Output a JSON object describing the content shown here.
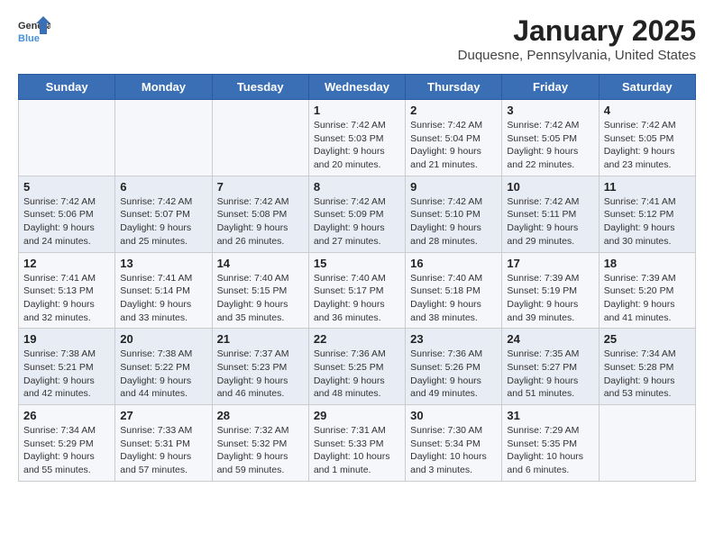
{
  "logo": {
    "text_general": "General",
    "text_blue": "Blue"
  },
  "calendar": {
    "title": "January 2025",
    "subtitle": "Duquesne, Pennsylvania, United States"
  },
  "days_of_week": [
    "Sunday",
    "Monday",
    "Tuesday",
    "Wednesday",
    "Thursday",
    "Friday",
    "Saturday"
  ],
  "weeks": [
    [
      {
        "day": "",
        "info": ""
      },
      {
        "day": "",
        "info": ""
      },
      {
        "day": "",
        "info": ""
      },
      {
        "day": "1",
        "info": "Sunrise: 7:42 AM\nSunset: 5:03 PM\nDaylight: 9 hours\nand 20 minutes."
      },
      {
        "day": "2",
        "info": "Sunrise: 7:42 AM\nSunset: 5:04 PM\nDaylight: 9 hours\nand 21 minutes."
      },
      {
        "day": "3",
        "info": "Sunrise: 7:42 AM\nSunset: 5:05 PM\nDaylight: 9 hours\nand 22 minutes."
      },
      {
        "day": "4",
        "info": "Sunrise: 7:42 AM\nSunset: 5:05 PM\nDaylight: 9 hours\nand 23 minutes."
      }
    ],
    [
      {
        "day": "5",
        "info": "Sunrise: 7:42 AM\nSunset: 5:06 PM\nDaylight: 9 hours\nand 24 minutes."
      },
      {
        "day": "6",
        "info": "Sunrise: 7:42 AM\nSunset: 5:07 PM\nDaylight: 9 hours\nand 25 minutes."
      },
      {
        "day": "7",
        "info": "Sunrise: 7:42 AM\nSunset: 5:08 PM\nDaylight: 9 hours\nand 26 minutes."
      },
      {
        "day": "8",
        "info": "Sunrise: 7:42 AM\nSunset: 5:09 PM\nDaylight: 9 hours\nand 27 minutes."
      },
      {
        "day": "9",
        "info": "Sunrise: 7:42 AM\nSunset: 5:10 PM\nDaylight: 9 hours\nand 28 minutes."
      },
      {
        "day": "10",
        "info": "Sunrise: 7:42 AM\nSunset: 5:11 PM\nDaylight: 9 hours\nand 29 minutes."
      },
      {
        "day": "11",
        "info": "Sunrise: 7:41 AM\nSunset: 5:12 PM\nDaylight: 9 hours\nand 30 minutes."
      }
    ],
    [
      {
        "day": "12",
        "info": "Sunrise: 7:41 AM\nSunset: 5:13 PM\nDaylight: 9 hours\nand 32 minutes."
      },
      {
        "day": "13",
        "info": "Sunrise: 7:41 AM\nSunset: 5:14 PM\nDaylight: 9 hours\nand 33 minutes."
      },
      {
        "day": "14",
        "info": "Sunrise: 7:40 AM\nSunset: 5:15 PM\nDaylight: 9 hours\nand 35 minutes."
      },
      {
        "day": "15",
        "info": "Sunrise: 7:40 AM\nSunset: 5:17 PM\nDaylight: 9 hours\nand 36 minutes."
      },
      {
        "day": "16",
        "info": "Sunrise: 7:40 AM\nSunset: 5:18 PM\nDaylight: 9 hours\nand 38 minutes."
      },
      {
        "day": "17",
        "info": "Sunrise: 7:39 AM\nSunset: 5:19 PM\nDaylight: 9 hours\nand 39 minutes."
      },
      {
        "day": "18",
        "info": "Sunrise: 7:39 AM\nSunset: 5:20 PM\nDaylight: 9 hours\nand 41 minutes."
      }
    ],
    [
      {
        "day": "19",
        "info": "Sunrise: 7:38 AM\nSunset: 5:21 PM\nDaylight: 9 hours\nand 42 minutes."
      },
      {
        "day": "20",
        "info": "Sunrise: 7:38 AM\nSunset: 5:22 PM\nDaylight: 9 hours\nand 44 minutes."
      },
      {
        "day": "21",
        "info": "Sunrise: 7:37 AM\nSunset: 5:23 PM\nDaylight: 9 hours\nand 46 minutes."
      },
      {
        "day": "22",
        "info": "Sunrise: 7:36 AM\nSunset: 5:25 PM\nDaylight: 9 hours\nand 48 minutes."
      },
      {
        "day": "23",
        "info": "Sunrise: 7:36 AM\nSunset: 5:26 PM\nDaylight: 9 hours\nand 49 minutes."
      },
      {
        "day": "24",
        "info": "Sunrise: 7:35 AM\nSunset: 5:27 PM\nDaylight: 9 hours\nand 51 minutes."
      },
      {
        "day": "25",
        "info": "Sunrise: 7:34 AM\nSunset: 5:28 PM\nDaylight: 9 hours\nand 53 minutes."
      }
    ],
    [
      {
        "day": "26",
        "info": "Sunrise: 7:34 AM\nSunset: 5:29 PM\nDaylight: 9 hours\nand 55 minutes."
      },
      {
        "day": "27",
        "info": "Sunrise: 7:33 AM\nSunset: 5:31 PM\nDaylight: 9 hours\nand 57 minutes."
      },
      {
        "day": "28",
        "info": "Sunrise: 7:32 AM\nSunset: 5:32 PM\nDaylight: 9 hours\nand 59 minutes."
      },
      {
        "day": "29",
        "info": "Sunrise: 7:31 AM\nSunset: 5:33 PM\nDaylight: 10 hours\nand 1 minute."
      },
      {
        "day": "30",
        "info": "Sunrise: 7:30 AM\nSunset: 5:34 PM\nDaylight: 10 hours\nand 3 minutes."
      },
      {
        "day": "31",
        "info": "Sunrise: 7:29 AM\nSunset: 5:35 PM\nDaylight: 10 hours\nand 6 minutes."
      },
      {
        "day": "",
        "info": ""
      }
    ]
  ]
}
